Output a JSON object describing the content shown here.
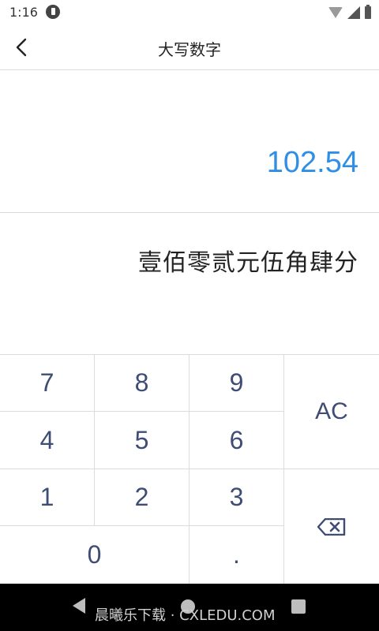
{
  "status_bar": {
    "time": "1:16"
  },
  "header": {
    "title": "大写数字"
  },
  "display": {
    "number": "102.54"
  },
  "result": {
    "text": "壹佰零贰元伍角肆分"
  },
  "keypad": {
    "keys": {
      "k7": "7",
      "k8": "8",
      "k9": "9",
      "k4": "4",
      "k5": "5",
      "k6": "6",
      "k1": "1",
      "k2": "2",
      "k3": "3",
      "k0": "0",
      "dot": ".",
      "ac": "AC"
    },
    "backspace_icon": "backspace-icon"
  },
  "watermark": "晨曦乐下载 · CXLEDU.COM"
}
